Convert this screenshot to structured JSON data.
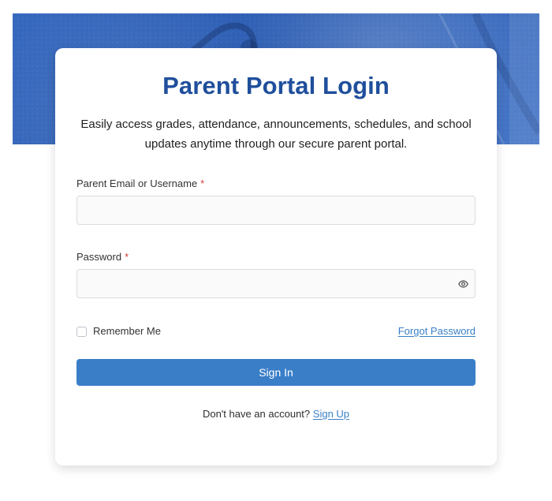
{
  "login": {
    "title": "Parent Portal Login",
    "subtitle": "Easily access grades, attendance, announcements, schedules, and school updates anytime through our secure parent portal.",
    "email": {
      "label": "Parent Email or Username",
      "required_mark": "*",
      "value": "",
      "placeholder": ""
    },
    "password": {
      "label": "Password",
      "required_mark": "*",
      "value": "",
      "placeholder": "",
      "visibility_icon": "eye-icon"
    },
    "remember_me_label": "Remember Me",
    "forgot_password_label": "Forgot Password",
    "signin_label": "Sign In",
    "signup_prompt": "Don't have an account?",
    "signup_label": "Sign Up"
  },
  "colors": {
    "title": "#1f4f9c",
    "banner": "#3467be",
    "button": "#3a7ec8",
    "link": "#3a7fc5",
    "required": "#d93b3b"
  }
}
